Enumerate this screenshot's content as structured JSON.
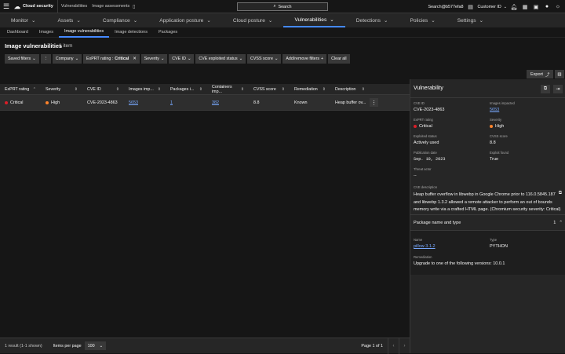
{
  "topbar": {
    "brand": "Cloud security",
    "crumb1": "Vulnerabilities",
    "crumb2": "Image assessments",
    "search_label": "Search",
    "user": "Search@b577efa8",
    "customer": "Customer ID"
  },
  "mainnav": [
    {
      "label": "Monitor"
    },
    {
      "label": "Assets"
    },
    {
      "label": "Compliance"
    },
    {
      "label": "Application posture"
    },
    {
      "label": "Cloud posture"
    },
    {
      "label": "Vulnerabilities"
    },
    {
      "label": "Detections"
    },
    {
      "label": "Policies"
    },
    {
      "label": "Settings"
    }
  ],
  "subnav": [
    "Dashboard",
    "Images",
    "Image vulnerabilities",
    "Image detections",
    "Packages"
  ],
  "page": {
    "title": "Image vulnerabilities",
    "count": "1 item"
  },
  "filters": {
    "saved": "Saved filters",
    "company": "Company",
    "exprt_label": "ExPRT rating :",
    "exprt_value": "Critical",
    "severity": "Severity",
    "cve_id": "CVE ID",
    "cve_exploited": "CVE exploited status",
    "cvss": "CVSS score",
    "add_remove": "Add/remove filters",
    "clear": "Clear all"
  },
  "actions": {
    "export": "Export"
  },
  "table": {
    "headers": [
      "ExPRT rating",
      "Severity",
      "CVE ID",
      "Images imp...",
      "Packages i...",
      "Containers imp...",
      "CVSS score",
      "Remediation",
      "Description"
    ],
    "row": {
      "exprt": "Critical",
      "severity": "High",
      "cve": "CVE-2023-4863",
      "images": "5653",
      "packages": "1",
      "containers": "382",
      "cvss": "8.8",
      "remediation": "Known",
      "description": "Heap buffer ov..."
    }
  },
  "footer": {
    "result": "1 result (1-1 shown)",
    "ipp_label": "Items per page",
    "ipp_value": "100",
    "page": "Page 1 of 1"
  },
  "panel": {
    "title": "Vulnerability",
    "fields": {
      "cve_label": "CVE ID",
      "cve_value": "CVE-2023-4863",
      "images_label": "Images impacted",
      "images_value": "5653",
      "exprt_label": "ExPRT rating",
      "exprt_value": "Critical",
      "sev_label": "Severity",
      "sev_value": "High",
      "exp_label": "Exploited status",
      "exp_value": "Actively used",
      "cvss_label": "CVSS score",
      "cvss_value": "8.8",
      "pub_label": "Publication date",
      "pub_value": "Sep. 10, 2023",
      "expf_label": "Exploit found",
      "expf_value": "True",
      "ta_label": "Threat actor",
      "ta_value": "--",
      "desc_label": "CVE description",
      "desc_value": "Heap buffer overflow in libwebp in Google Chrome prior to 116.0.5845.187 and libwebp 1.3.2 allowed a remote attacker to perform an out of bounds memory write via a crafted HTML page. (Chromium security severity: Critical)"
    },
    "section": {
      "title": "Package name and type",
      "count": "1"
    },
    "package": {
      "name_label": "Name",
      "name_value": "pillow 3.1.2",
      "type_label": "Type",
      "type_value": "PYTHON",
      "rem_label": "Remediation",
      "rem_value": "Upgrade to one of the following versions: 10.0.1"
    }
  },
  "colors": {
    "critical": "#da1e28",
    "high": "#ff832b",
    "accent": "#4589ff",
    "link": "#78a9ff"
  }
}
